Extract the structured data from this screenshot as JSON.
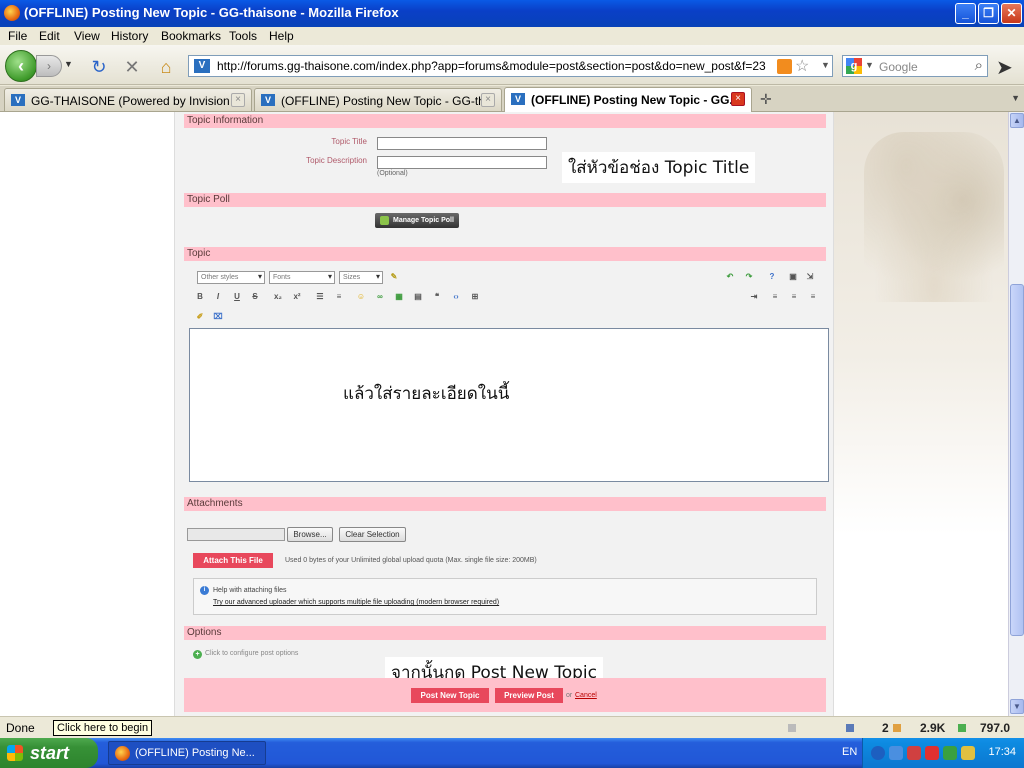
{
  "window": {
    "title": "(OFFLINE) Posting New Topic - GG-thaisone - Mozilla Firefox",
    "minimize": "_",
    "maximize": "❐",
    "close": "✕"
  },
  "menu": [
    "File",
    "Edit",
    "View",
    "History",
    "Bookmarks",
    "Tools",
    "Help"
  ],
  "nav": {
    "url": "http://forums.gg-thaisone.com/index.php?app=forums&module=post&section=post&do=new_post&f=23",
    "search_placeholder": "Google",
    "favicon_letter": "V"
  },
  "tabs": [
    {
      "label": "GG-THAISONE (Powered by Invision Po...",
      "active": false
    },
    {
      "label": "(OFFLINE) Posting New Topic - GG-thai...",
      "active": false
    },
    {
      "label": "(OFFLINE) Posting New Topic - GG...",
      "active": true
    }
  ],
  "form": {
    "topic_info_header": "Topic Information",
    "topic_title_label": "Topic Title",
    "topic_desc_label": "Topic Description",
    "optional_note": "(Optional)",
    "annotation_title": "ใส่หัวข้อช่อง Topic Title",
    "poll_header": "Topic Poll",
    "manage_poll_button": "Manage Topic Poll",
    "topic_header": "Topic",
    "style_select": "Other styles",
    "font_select": "Fonts",
    "size_select": "Sizes",
    "annotation_body": "แล้วใส่รายละเอียดในนี้",
    "attachments_header": "Attachments",
    "browse_button": "Browse...",
    "clear_button": "Clear Selection",
    "attach_button": "Attach This File",
    "quota_text": "Used 0 bytes of your Unlimited global upload quota (Max. single file size: 200MB)",
    "help_title": "Help with attaching files",
    "help_link": "Try our advanced uploader which supports multiple file uploading (modern browser required)",
    "options_header": "Options",
    "options_link": "Click to configure post options",
    "annotation_post": "จากนั้นกด Post New Topic",
    "post_button": "Post New Topic",
    "preview_button": "Preview Post",
    "or_text": "or",
    "cancel_link": "Cancel"
  },
  "status": {
    "text": "Done",
    "tooltip": "Click here to begin",
    "count": "2",
    "size": "2.9K",
    "traffic": "797.0"
  },
  "taskbar": {
    "start": "start",
    "task": "(OFFLINE) Posting Ne...",
    "lang": "EN",
    "clock": "17:34"
  },
  "colors": {
    "section_header": "#ffc0cb",
    "attach_button": "#e8485c",
    "taskbar": "#245edb",
    "start_button": "#379137"
  }
}
